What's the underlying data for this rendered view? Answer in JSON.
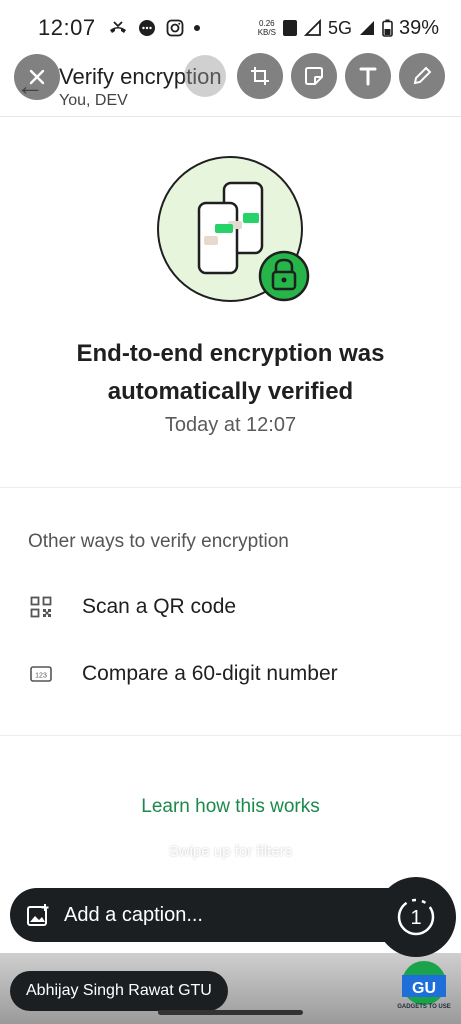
{
  "status_bar": {
    "time": "12:07",
    "net_speed_value": "0.26",
    "net_speed_unit": "KB/S",
    "network": "5G",
    "battery": "39%"
  },
  "header": {
    "title": "Verify encryption",
    "subtitle": "You, DEV"
  },
  "main": {
    "heading_line1": "End-to-end encryption was",
    "heading_line2": "automatically verified",
    "verified_time": "Today at 12:07",
    "section_label": "Other ways to verify encryption",
    "options": [
      {
        "label": "Scan a QR code",
        "icon": "qr-code-icon"
      },
      {
        "label": "Compare a 60-digit number",
        "icon": "number-123-icon"
      }
    ],
    "learn_link": "Learn how this works"
  },
  "editor": {
    "tools": [
      "close-icon",
      "crop-rotate-icon",
      "sticker-icon",
      "text-icon",
      "pencil-icon"
    ],
    "swipe_hint": "Swipe up for filters",
    "caption_placeholder": "Add a caption...",
    "view_once_label": "1",
    "recipient": "Abhijay Singh Rawat GTU"
  },
  "colors": {
    "accent_green": "#1a8a4a",
    "illustration_bg": "#e6f5dc",
    "lock_green": "#25b548",
    "dark_pill": "#1b1f21"
  }
}
